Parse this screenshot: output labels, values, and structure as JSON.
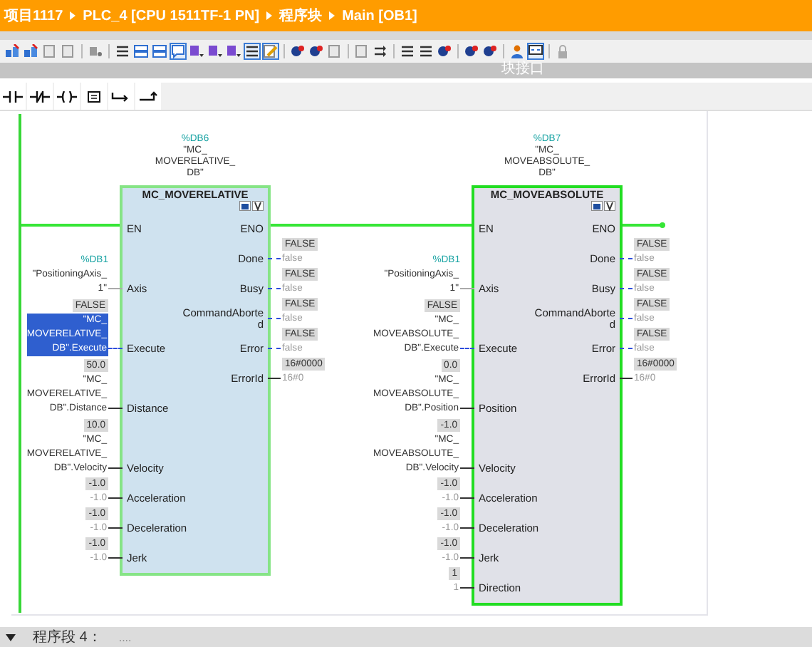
{
  "breadcrumb": [
    "项目1117",
    "PLC_4 [CPU 1511TF-1 PN]",
    "程序块",
    "Main [OB1]"
  ],
  "toolbar": [
    {
      "on": false
    },
    {
      "on": false
    },
    {
      "on": false
    },
    {
      "on": false
    },
    {
      "on": false
    },
    {
      "on": false
    },
    {
      "on": false
    },
    {
      "on": false
    },
    {
      "on": true
    },
    {
      "on": false
    },
    {
      "on": false
    },
    {
      "on": false
    },
    {
      "on": true
    },
    {
      "on": true
    },
    {
      "on": false
    },
    {
      "on": false
    },
    {
      "on": false
    },
    {
      "on": false
    },
    {
      "on": false
    },
    {
      "on": false
    },
    {
      "on": false
    },
    {
      "on": false
    },
    {
      "on": false
    },
    {
      "on": false
    },
    {
      "on": false
    },
    {
      "on": true
    },
    {
      "on": false
    }
  ],
  "panel_header": "块接口",
  "ladder_toolbar": [
    {
      "kind": "contact"
    },
    {
      "kind": "contact_nc"
    },
    {
      "kind": "coil"
    },
    {
      "kind": "box"
    },
    {
      "kind": "branch_open"
    },
    {
      "kind": "branch_close"
    }
  ],
  "blocks": [
    {
      "address": "%DB6",
      "instance": [
        "\"MC_",
        "MOVERELATIVE_",
        "DB\""
      ],
      "type": "MC_MOVERELATIVE",
      "selected": true,
      "inputs": [
        {
          "pin": "EN",
          "kind": "power"
        },
        {
          "pin": "Axis",
          "kind": "axis",
          "address": "%DB1",
          "operand": [
            "\"PositioningAxis_",
            "1\""
          ],
          "selected": false
        },
        {
          "pin": "Execute",
          "kind": "bool",
          "monitor": "FALSE",
          "operand": [
            "\"MC_",
            "MOVERELATIVE_",
            "DB\".Execute"
          ],
          "selected": true
        },
        {
          "pin": "Distance",
          "kind": "data",
          "monitor": "50.0",
          "operand": [
            "\"MC_",
            "MOVERELATIVE_",
            "DB\".Distance"
          ],
          "selected": false
        },
        {
          "pin": "Velocity",
          "kind": "data",
          "monitor": "10.0",
          "operand": [
            "\"MC_",
            "MOVERELATIVE_",
            "DB\".Velocity"
          ],
          "selected": false
        },
        {
          "pin": "Acceleration",
          "kind": "constant",
          "monitor": "-1.0",
          "operand": [
            "-1.0"
          ],
          "selected": false
        },
        {
          "pin": "Deceleration",
          "kind": "constant",
          "monitor": "-1.0",
          "operand": [
            "-1.0"
          ],
          "selected": false
        },
        {
          "pin": "Jerk",
          "kind": "constant",
          "monitor": "-1.0",
          "operand": [
            "-1.0"
          ],
          "selected": false
        }
      ],
      "outputs": [
        {
          "pin": "ENO",
          "kind": "power"
        },
        {
          "pin": "Done",
          "kind": "bool",
          "monitor": "FALSE",
          "value": "false"
        },
        {
          "pin": "Busy",
          "kind": "bool",
          "monitor": "FALSE",
          "value": "false"
        },
        {
          "pin": "CommandAborted",
          "kind": "bool",
          "monitor": "FALSE",
          "value": "false"
        },
        {
          "pin": "Error",
          "kind": "bool",
          "monitor": "FALSE",
          "value": "false"
        },
        {
          "pin": "ErrorId",
          "kind": "data",
          "monitor": "16#0000",
          "value": "16#0"
        }
      ]
    },
    {
      "address": "%DB7",
      "instance": [
        "\"MC_",
        "MOVEABSOLUTE_",
        "DB\""
      ],
      "type": "MC_MOVEABSOLUTE",
      "selected": false,
      "inputs": [
        {
          "pin": "EN",
          "kind": "power"
        },
        {
          "pin": "Axis",
          "kind": "axis",
          "address": "%DB1",
          "operand": [
            "\"PositioningAxis_",
            "1\""
          ],
          "selected": false
        },
        {
          "pin": "Execute",
          "kind": "bool",
          "monitor": "FALSE",
          "operand": [
            "\"MC_",
            "MOVEABSOLUTE_",
            "DB\".Execute"
          ],
          "selected": false
        },
        {
          "pin": "Position",
          "kind": "data",
          "monitor": "0.0",
          "operand": [
            "\"MC_",
            "MOVEABSOLUTE_",
            "DB\".Position"
          ],
          "selected": false
        },
        {
          "pin": "Velocity",
          "kind": "data",
          "monitor": "-1.0",
          "operand": [
            "\"MC_",
            "MOVEABSOLUTE_",
            "DB\".Velocity"
          ],
          "selected": false
        },
        {
          "pin": "Acceleration",
          "kind": "constant",
          "monitor": "-1.0",
          "operand": [
            "-1.0"
          ],
          "selected": false
        },
        {
          "pin": "Deceleration",
          "kind": "constant",
          "monitor": "-1.0",
          "operand": [
            "-1.0"
          ],
          "selected": false
        },
        {
          "pin": "Jerk",
          "kind": "constant",
          "monitor": "-1.0",
          "operand": [
            "-1.0"
          ],
          "selected": false
        },
        {
          "pin": "Direction",
          "kind": "constant",
          "monitor": "1",
          "operand": [
            "1"
          ],
          "selected": false
        }
      ],
      "outputs": [
        {
          "pin": "ENO",
          "kind": "power"
        },
        {
          "pin": "Done",
          "kind": "bool",
          "monitor": "FALSE",
          "value": "false"
        },
        {
          "pin": "Busy",
          "kind": "bool",
          "monitor": "FALSE",
          "value": "false"
        },
        {
          "pin": "CommandAborted",
          "kind": "bool",
          "monitor": "FALSE",
          "value": "false"
        },
        {
          "pin": "Error",
          "kind": "bool",
          "monitor": "FALSE",
          "value": "false"
        },
        {
          "pin": "ErrorId",
          "kind": "data",
          "monitor": "16#0000",
          "value": "16#0"
        }
      ]
    }
  ],
  "footer": {
    "expanded": true,
    "title": "程序段 4：",
    "comment": "...."
  }
}
